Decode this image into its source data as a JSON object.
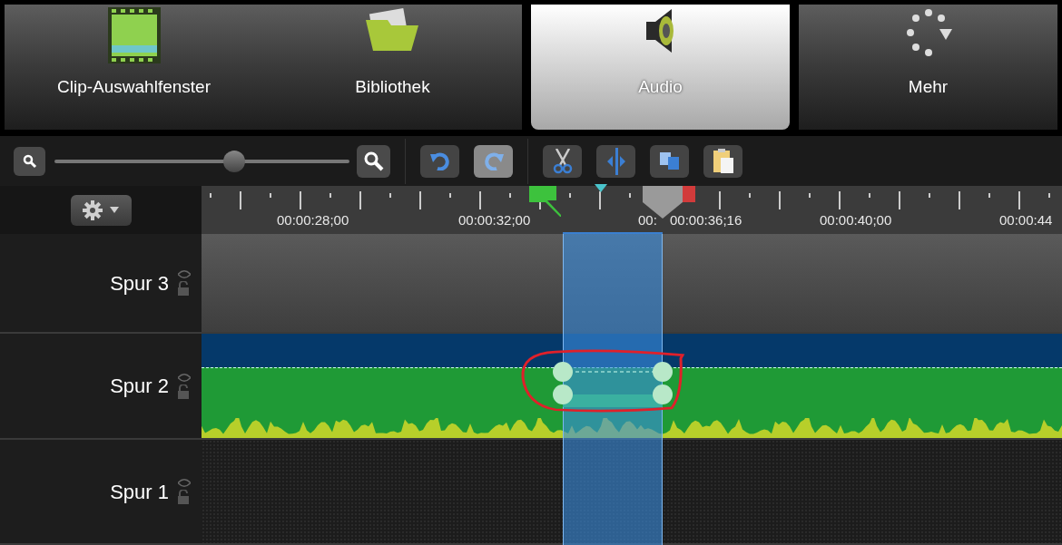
{
  "tabs": [
    {
      "label": "Clip-Auswahlfenster",
      "kind": "clip",
      "selected": false
    },
    {
      "label": "Bibliothek",
      "kind": "library",
      "selected": false
    },
    {
      "label": "Audio",
      "kind": "audio",
      "selected": true
    },
    {
      "label": "Mehr",
      "kind": "more",
      "selected": false
    }
  ],
  "toolbar": {
    "zoom": {
      "level": 0.61
    },
    "buttons": [
      {
        "kind": "undo",
        "disabled": false
      },
      {
        "kind": "redo",
        "disabled": true
      },
      {
        "kind": "cut",
        "disabled": false
      },
      {
        "kind": "split",
        "disabled": false
      },
      {
        "kind": "copy",
        "disabled": false
      },
      {
        "kind": "paste",
        "disabled": false
      }
    ]
  },
  "ruler": {
    "labels": [
      "00:00:28;00",
      "00:00:32;00",
      "00:",
      "00:00:36;16",
      "00:00:40;00",
      "00:00:44"
    ]
  },
  "tracks": [
    {
      "name": "Spur 3",
      "kind": "empty"
    },
    {
      "name": "Spur 2",
      "kind": "audio"
    },
    {
      "name": "Spur 1",
      "kind": "blank"
    }
  ]
}
